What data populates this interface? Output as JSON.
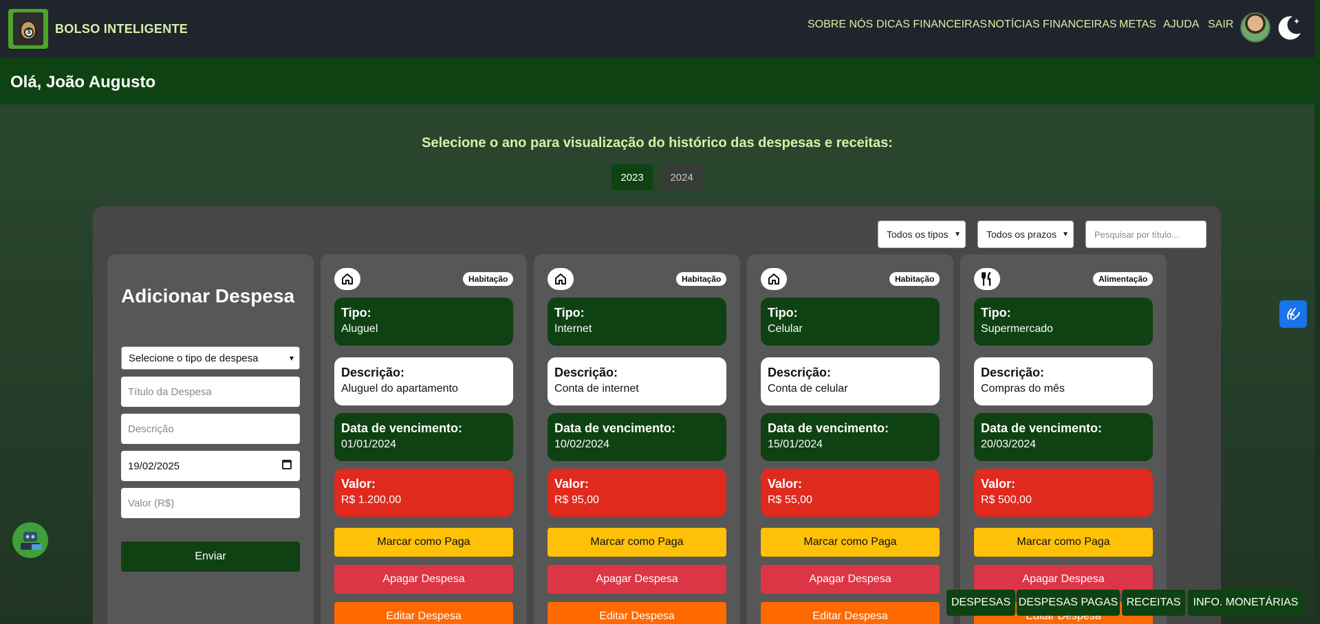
{
  "brand": {
    "name": "BOLSO INTELIGENTE"
  },
  "nav": [
    "SOBRE NÓS",
    "DICAS FINANCEIRAS",
    "NOTÍCIAS FINANCEIRAS",
    "METAS",
    "AJUDA",
    "SAIR"
  ],
  "greeting": "Olá, João Augusto",
  "year_select": {
    "title": "Selecione o ano para visualização do histórico das despesas e receitas:",
    "years": [
      "2023",
      "2024"
    ],
    "active": "2023"
  },
  "filters": {
    "type": "Todos os tipos",
    "deadline": "Todos os prazos",
    "search_placeholder": "Pesquisar por título..."
  },
  "form": {
    "title": "Adicionar Despesa",
    "type_select": "Selecione o tipo de despesa",
    "title_placeholder": "Título da Despesa",
    "description_placeholder": "Descrição",
    "date_value": "19/02/2025",
    "value_placeholder": "Valor (R$)",
    "submit": "Enviar"
  },
  "labels": {
    "tipo": "Tipo:",
    "descricao": "Descrição:",
    "vencimento": "Data de vencimento:",
    "valor": "Valor:"
  },
  "actions": {
    "pay": "Marcar como Paga",
    "delete": "Apagar Despesa",
    "edit": "Editar Despesa"
  },
  "expenses": [
    {
      "category": "Habitação",
      "icon": "house-icon",
      "tipo": "Aluguel",
      "descricao": "Aluguel do apartamento",
      "vencimento": "01/01/2024",
      "valor": "R$ 1.200,00"
    },
    {
      "category": "Habitação",
      "icon": "house-icon",
      "tipo": "Internet",
      "descricao": "Conta de internet",
      "vencimento": "10/02/2024",
      "valor": "R$ 95,00"
    },
    {
      "category": "Habitação",
      "icon": "house-icon",
      "tipo": "Celular",
      "descricao": "Conta de celular",
      "vencimento": "15/01/2024",
      "valor": "R$ 55,00"
    },
    {
      "category": "Alimentação",
      "icon": "fork-knife-icon",
      "tipo": "Supermercado",
      "descricao": "Compras do mês",
      "vencimento": "20/03/2024",
      "valor": "R$ 500,00"
    }
  ],
  "bottom_nav": [
    "DESPESAS",
    "DESPESAS PAGAS",
    "RECEITAS",
    "INFO. MONETÁRIAS"
  ],
  "colors": {
    "topbar": "#20242c",
    "accent_green": "#0e4212",
    "value_red": "#e02a1e",
    "pay_yellow": "#ffc107",
    "delete_red": "#dc3545",
    "edit_orange": "#ff6a00",
    "nav_text": "#d6f2a8"
  }
}
